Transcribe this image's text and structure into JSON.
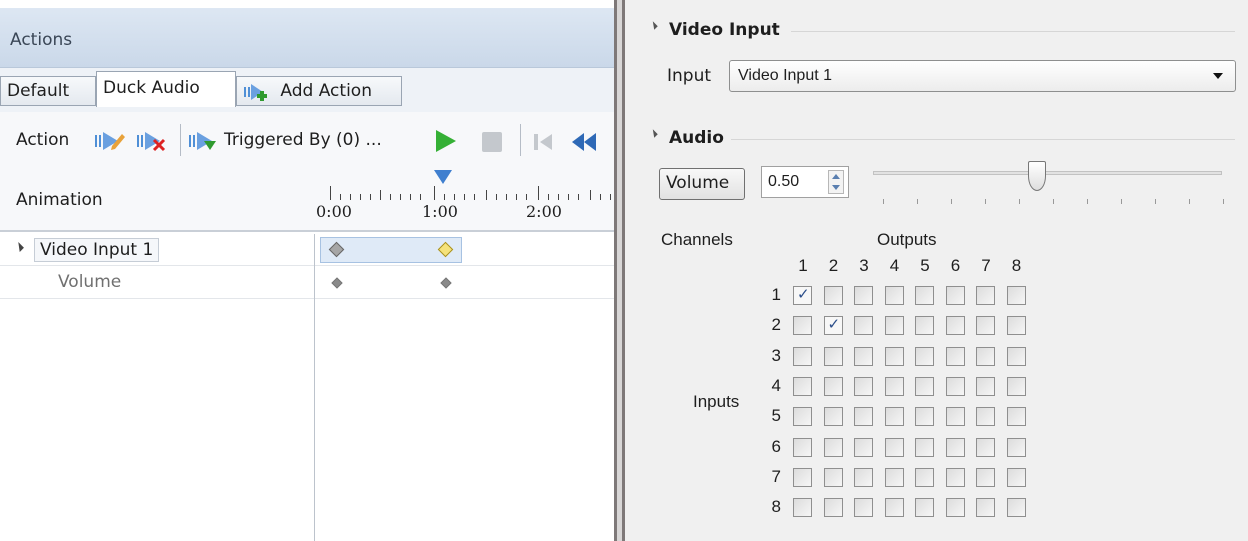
{
  "actions_panel": {
    "title": "Actions",
    "tabs": [
      {
        "label": "Default",
        "active": false
      },
      {
        "label": "Duck Audio",
        "active": true
      },
      {
        "label": "Add Action",
        "active": false,
        "icon": "add-action-icon"
      }
    ],
    "toolbar": {
      "action_label": "Action",
      "triggered_by_label": "Triggered By (0) ...",
      "icons": [
        "add-trigger-icon",
        "remove-trigger-icon",
        "triggered-by-icon",
        "play-icon",
        "stop-icon",
        "skip-to-start-icon",
        "rewind-icon"
      ]
    },
    "animation": {
      "label": "Animation",
      "ticks": [
        "0:00",
        "1:00",
        "2:00"
      ]
    },
    "tree": [
      {
        "label": "Video Input 1",
        "expanded": true
      },
      {
        "label": "Volume"
      }
    ]
  },
  "properties_panel": {
    "video_input": {
      "section_title": "Video Input",
      "input_label": "Input",
      "input_value": "Video Input 1"
    },
    "audio": {
      "section_title": "Audio",
      "volume_button": "Volume",
      "volume_value": "0.50",
      "volume_level": 0.5,
      "channels_label": "Channels",
      "outputs_label": "Outputs",
      "inputs_label": "Inputs",
      "output_numbers": [
        "1",
        "2",
        "3",
        "4",
        "5",
        "6",
        "7",
        "8"
      ],
      "input_numbers": [
        "1",
        "2",
        "3",
        "4",
        "5",
        "6",
        "7",
        "8"
      ],
      "routing_checked": [
        [
          1,
          1
        ],
        [
          2,
          2
        ]
      ]
    }
  }
}
